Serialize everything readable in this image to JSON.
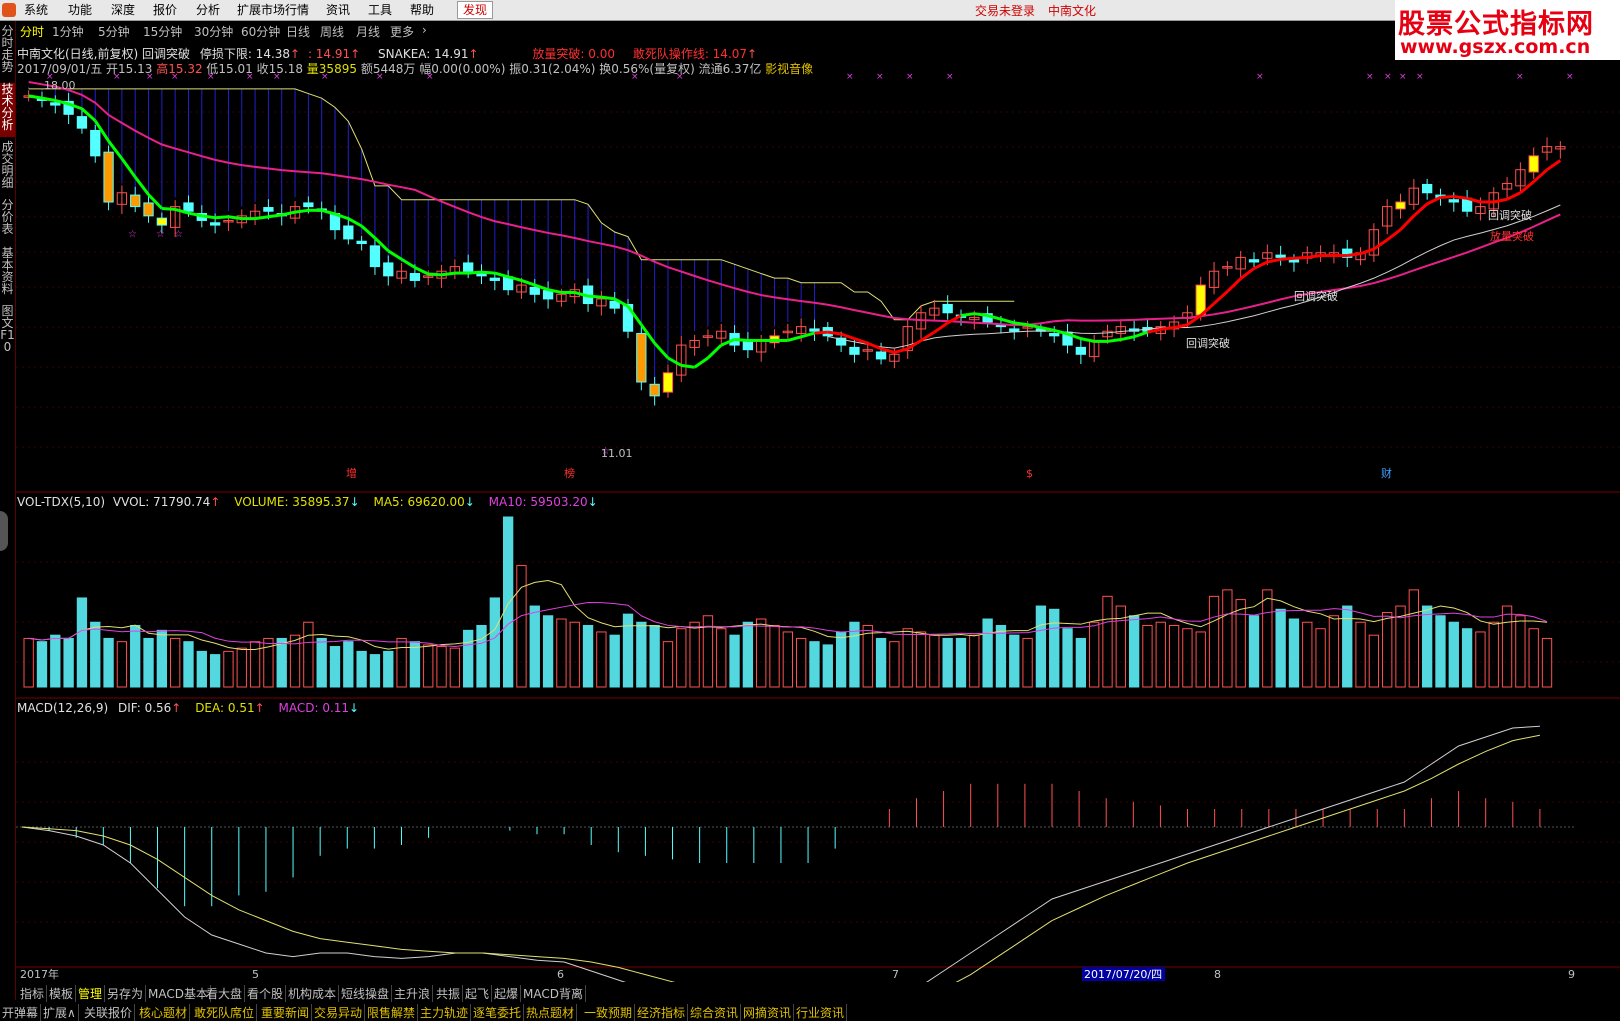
{
  "menubar": {
    "items": [
      "系统",
      "功能",
      "深度",
      "报价",
      "分析",
      "扩展市场行情",
      "资讯",
      "工具",
      "帮助",
      "发现"
    ],
    "trade_status": "交易未登录",
    "stock_name": "中南文化"
  },
  "watermark": {
    "line1": "股票公式指标网",
    "line2": "www.gszx.com.cn"
  },
  "left_tabs": [
    "分时走势",
    "技术分析",
    "成交明细",
    "分价表",
    "基本资料",
    "图文F10"
  ],
  "period_tabs": [
    "分时",
    "1分钟",
    "5分钟",
    "15分钟",
    "30分钟",
    "60分钟",
    "日线",
    "周线",
    "月线",
    "更多",
    "›"
  ],
  "price_header": {
    "title": "中南文化(日线,前复权) 回调突破",
    "limit_down_label": "停损下限: 14.38",
    "limit_down_value2": ": 14.91",
    "snake": "SNAKEA: 14.91",
    "volume_break": "放量突破: 0.00",
    "dare_die": "敢死队操作线: 14.07"
  },
  "info_line": {
    "date": "2017/09/01/五",
    "open": "开15.13",
    "high": "高15.32",
    "low": "低15.01",
    "close": "收15.18",
    "volume": "量35895",
    "amount": "额5448万",
    "change": "幅0.00(0.00%)",
    "amplitude": "振0.31(2.04%)",
    "turnover": "换0.56%(量复权)",
    "float": "流通6.37亿",
    "media": "影视音像"
  },
  "price_annotations": {
    "high_price": "18.00",
    "low_price": "11.01",
    "signal1": "回调突破",
    "signal2": "回调突破",
    "signal3": "回调突破",
    "signal4": "放量突破",
    "marker_zeng": "增",
    "marker_bang": "榜",
    "marker_dollar": "$",
    "marker_cai": "财"
  },
  "vol_header": {
    "name": "VOL-TDX(5,10)",
    "vvol": "VVOL: 71790.74",
    "volume": "VOLUME: 35895.37",
    "ma5": "MA5: 69620.00",
    "ma10": "MA10: 59503.20"
  },
  "macd_header": {
    "name": "MACD(12,26,9)",
    "dif": "DIF: 0.56",
    "dea": "DEA: 0.51",
    "macd": "MACD: 0.11"
  },
  "x_axis": {
    "labels": [
      "2017年",
      "5",
      "6",
      "7",
      "2017/07/20/四",
      "8",
      "9"
    ]
  },
  "bottom_tabs_row1": [
    "指标",
    "模板",
    "管理",
    "另存为",
    "MACD基本",
    "看大盘",
    "看个股",
    "机构成本",
    "短线操盘",
    "主升浪",
    "共振",
    "起飞",
    "起爆",
    "MACD背离"
  ],
  "bottom_tabs_row2": [
    "开弹幕",
    "扩展∧",
    "关联报价",
    "核心题材",
    "敢死队席位",
    "重要新闻",
    "交易异动",
    "限售解禁",
    "主力轨迹",
    "逐笔委托",
    "热点题材",
    "一致预期",
    "经济指标",
    "综合资讯",
    "网摘资讯",
    "行业资讯"
  ],
  "colors": {
    "up": "#ff5050",
    "down": "#54ffff",
    "green_line": "#00ff00",
    "red_line": "#ff0000",
    "magenta_line": "#e8208c",
    "white_line": "#d0d0d0",
    "yellow_line": "#e0e070",
    "blue_fill": "#2020d0",
    "volume_up": "#ff5050",
    "volume_down": "#54d8e0"
  },
  "chart_data": {
    "type": "candlestick",
    "y_price_range": [
      10.5,
      18.3
    ],
    "high": 18.0,
    "low": 11.01,
    "close_series": [
      18.0,
      17.9,
      17.8,
      17.6,
      17.3,
      16.7,
      15.7,
      15.9,
      15.6,
      15.4,
      15.2,
      15.6,
      15.5,
      15.3,
      15.2,
      15.3,
      15.4,
      15.5,
      15.5,
      15.4,
      15.6,
      15.6,
      15.5,
      15.1,
      14.9,
      14.8,
      14.3,
      14.1,
      14.2,
      14.0,
      14.1,
      14.2,
      14.3,
      14.2,
      14.1,
      14.0,
      13.8,
      13.9,
      13.7,
      13.6,
      13.7,
      13.8,
      13.5,
      13.6,
      13.4,
      12.9,
      11.8,
      11.5,
      12.0,
      12.6,
      12.7,
      12.8,
      12.9,
      12.6,
      12.5,
      12.7,
      12.8,
      12.9,
      13.0,
      12.9,
      12.8,
      12.6,
      12.4,
      12.5,
      12.3,
      12.4,
      13.0,
      13.3,
      13.4,
      13.3,
      13.2,
      13.2,
      13.1,
      13.0,
      12.9,
      13.0,
      12.9,
      12.8,
      12.6,
      12.4,
      12.7,
      12.9,
      13.0,
      12.9,
      12.9,
      13.0,
      13.1,
      13.3,
      13.9,
      14.2,
      14.3,
      14.5,
      14.4,
      14.6,
      14.5,
      14.4,
      14.6,
      14.6,
      14.6,
      14.5,
      14.6,
      15.1,
      15.6,
      15.7,
      16.0,
      15.9,
      15.8,
      15.7,
      15.5,
      15.6,
      15.9,
      16.1,
      16.4,
      16.7,
      16.9,
      16.9
    ],
    "volume_series": [
      30,
      28,
      32,
      30,
      55,
      40,
      30,
      28,
      38,
      30,
      35,
      30,
      28,
      22,
      20,
      22,
      24,
      28,
      30,
      30,
      32,
      40,
      30,
      25,
      28,
      22,
      20,
      22,
      30,
      28,
      26,
      25,
      24,
      35,
      38,
      55,
      105,
      75,
      50,
      44,
      42,
      40,
      38,
      34,
      32,
      45,
      40,
      38,
      28,
      36,
      40,
      44,
      36,
      32,
      40,
      42,
      38,
      34,
      30,
      28,
      26,
      34,
      40,
      38,
      30,
      28,
      36,
      34,
      32,
      30,
      30,
      32,
      42,
      38,
      32,
      30,
      50,
      48,
      36,
      30,
      40,
      56,
      50,
      44,
      38,
      40,
      38,
      36,
      34,
      56,
      60,
      54,
      44,
      60,
      48,
      42,
      40,
      36,
      44,
      50,
      40,
      32,
      46,
      50,
      60,
      50,
      44,
      40,
      36,
      34,
      40,
      50,
      44,
      36,
      30
    ],
    "dif_series": [
      0.0,
      -0.02,
      -0.05,
      -0.1,
      -0.2,
      -0.35,
      -0.5,
      -0.6,
      -0.65,
      -0.7,
      -0.72,
      -0.7,
      -0.7,
      -0.72,
      -0.73,
      -0.72,
      -0.7,
      -0.7,
      -0.72,
      -0.74,
      -0.75,
      -0.8,
      -0.85,
      -0.9,
      -0.95,
      -1.0,
      -1.05,
      -1.1,
      -1.15,
      -1.2,
      -1.18,
      -1.1,
      -1.0,
      -0.9,
      -0.8,
      -0.7,
      -0.6,
      -0.5,
      -0.4,
      -0.35,
      -0.3,
      -0.25,
      -0.2,
      -0.15,
      -0.1,
      -0.05,
      0.0,
      0.05,
      0.1,
      0.15,
      0.2,
      0.25,
      0.35,
      0.45,
      0.5,
      0.55,
      0.56
    ],
    "dea_series": [
      0.0,
      -0.01,
      -0.02,
      -0.05,
      -0.1,
      -0.18,
      -0.28,
      -0.38,
      -0.46,
      -0.52,
      -0.58,
      -0.62,
      -0.64,
      -0.66,
      -0.68,
      -0.69,
      -0.7,
      -0.7,
      -0.71,
      -0.72,
      -0.73,
      -0.75,
      -0.78,
      -0.82,
      -0.86,
      -0.9,
      -0.95,
      -1.0,
      -1.05,
      -1.1,
      -1.12,
      -1.1,
      -1.05,
      -0.98,
      -0.9,
      -0.82,
      -0.72,
      -0.62,
      -0.52,
      -0.45,
      -0.38,
      -0.32,
      -0.26,
      -0.2,
      -0.15,
      -0.1,
      -0.05,
      0.0,
      0.05,
      0.1,
      0.15,
      0.2,
      0.27,
      0.35,
      0.42,
      0.48,
      0.51
    ]
  }
}
